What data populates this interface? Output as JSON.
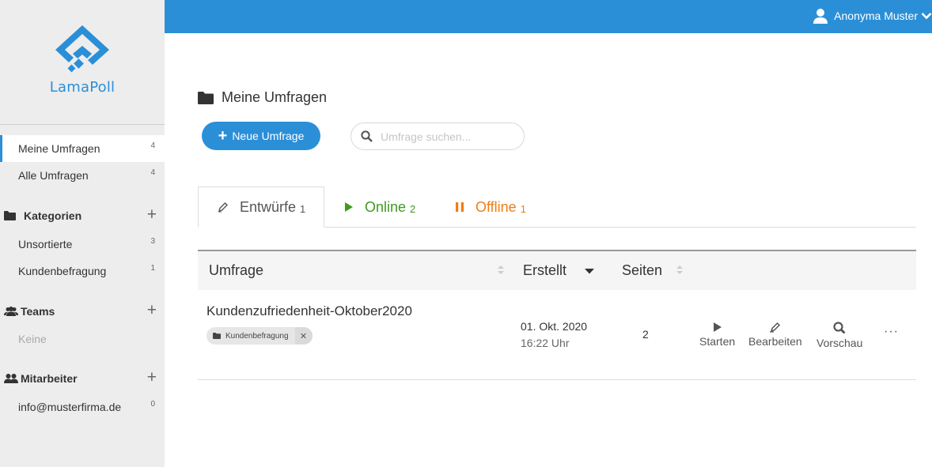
{
  "app": {
    "logo_text": "LamaPoll",
    "brand_color": "#2b8fd8"
  },
  "user": {
    "name": "Anonyma Muster",
    "icon": "user-icon"
  },
  "sidebar": {
    "my_surveys": {
      "label": "Meine Umfragen",
      "count": "4"
    },
    "all_surveys": {
      "label": "Alle Umfragen",
      "count": "4"
    },
    "categories": {
      "title": "Kategorien",
      "items": [
        {
          "label": "Unsortierte",
          "count": "3"
        },
        {
          "label": "Kundenbefragung",
          "count": "1"
        }
      ]
    },
    "teams": {
      "title": "Teams",
      "empty": "Keine"
    },
    "staff": {
      "title": "Mitarbeiter",
      "items": [
        {
          "label": "info@musterfirma.de",
          "count": "0"
        }
      ]
    }
  },
  "main": {
    "title": "Meine Umfragen",
    "new_button": "Neue Umfrage",
    "search_placeholder": "Umfrage suchen...",
    "tabs": [
      {
        "label": "Entwürfe",
        "count": "1",
        "color": "#555555"
      },
      {
        "label": "Online",
        "count": "2",
        "color": "#3f9a1f"
      },
      {
        "label": "Offline",
        "count": "1",
        "color": "#ee7d14"
      }
    ],
    "table": {
      "headers": {
        "survey": "Umfrage",
        "created": "Erstellt",
        "pages": "Seiten"
      },
      "rows": [
        {
          "title": "Kundenzufriedenheit-Oktober2020",
          "tag": "Kundenbefragung",
          "date": "01. Okt. 2020",
          "time": "16:22 Uhr",
          "pages": "2",
          "actions": {
            "start": "Starten",
            "edit": "Bearbeiten",
            "preview": "Vorschau",
            "more": "···"
          }
        }
      ]
    }
  }
}
